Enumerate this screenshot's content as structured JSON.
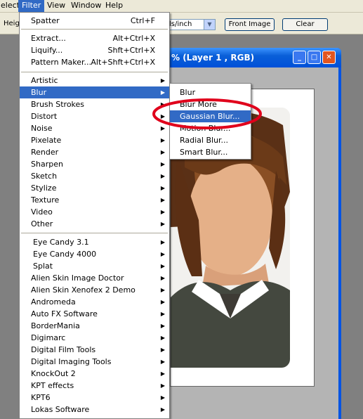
{
  "menubar": {
    "items": [
      {
        "label": "elect"
      },
      {
        "label": "Filter"
      },
      {
        "label": "View"
      },
      {
        "label": "Window"
      },
      {
        "label": "Help"
      }
    ]
  },
  "options_bar": {
    "height_label": "Heig",
    "resolution_unit": "ls/inch",
    "front_image_label": "Front Image",
    "clear_label": "Clear"
  },
  "document": {
    "title": "% (Layer 1 , RGB)"
  },
  "filter_menu": {
    "items": [
      {
        "label": "Spatter",
        "shortcut": "Ctrl+F"
      },
      {
        "label": "Extract...",
        "shortcut": "Alt+Ctrl+X"
      },
      {
        "label": "Liquify...",
        "shortcut": "Shft+Ctrl+X"
      },
      {
        "label": "Pattern Maker...",
        "shortcut": "Alt+Shft+Ctrl+X"
      },
      {
        "label": "Artistic"
      },
      {
        "label": "Blur"
      },
      {
        "label": "Brush Strokes"
      },
      {
        "label": "Distort"
      },
      {
        "label": "Noise"
      },
      {
        "label": "Pixelate"
      },
      {
        "label": "Render"
      },
      {
        "label": "Sharpen"
      },
      {
        "label": "Sketch"
      },
      {
        "label": "Stylize"
      },
      {
        "label": "Texture"
      },
      {
        "label": "Video"
      },
      {
        "label": "Other"
      },
      {
        "label": "Eye Candy 3.1"
      },
      {
        "label": "Eye Candy 4000"
      },
      {
        "label": "Splat"
      },
      {
        "label": "Alien Skin Image Doctor"
      },
      {
        "label": "Alien Skin Xenofex 2 Demo"
      },
      {
        "label": "Andromeda"
      },
      {
        "label": "Auto FX Software"
      },
      {
        "label": "BorderMania"
      },
      {
        "label": "Digimarc"
      },
      {
        "label": "Digital Film Tools"
      },
      {
        "label": "Digital Imaging Tools"
      },
      {
        "label": "KnockOut 2"
      },
      {
        "label": "KPT effects"
      },
      {
        "label": "KPT6"
      },
      {
        "label": "Lokas Software"
      }
    ]
  },
  "blur_submenu": {
    "items": [
      {
        "label": "Blur"
      },
      {
        "label": "Blur More"
      },
      {
        "label": "Gaussian Blur..."
      },
      {
        "label": "Motion Blur..."
      },
      {
        "label": "Radial Blur..."
      },
      {
        "label": "Smart Blur..."
      }
    ]
  },
  "colors": {
    "highlight": "#316ac5",
    "annotation_ellipse": "#e0001b",
    "titlebar": "#0054e3"
  }
}
